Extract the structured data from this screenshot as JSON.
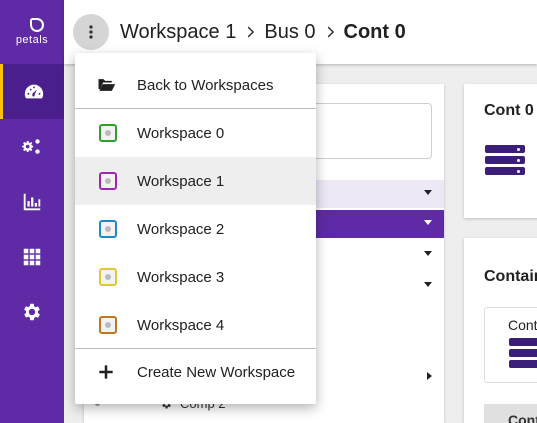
{
  "app": {
    "logo_text": "petals"
  },
  "breadcrumb": {
    "items": [
      "Workspace 1",
      "Bus 0",
      "Cont 0"
    ]
  },
  "sidebar": {
    "items": [
      {
        "id": "dashboard",
        "icon": "dashboard-icon",
        "active": true
      },
      {
        "id": "admin",
        "icon": "gears-icon",
        "active": false
      },
      {
        "id": "monitoring",
        "icon": "bar-chart-icon",
        "active": false
      },
      {
        "id": "apps",
        "icon": "grid-icon",
        "active": false
      },
      {
        "id": "settings",
        "icon": "gear-icon",
        "active": false
      }
    ]
  },
  "menu": {
    "back_label": "Back to Workspaces",
    "workspaces": [
      {
        "label": "Workspace 0",
        "color": "#2e9e2e"
      },
      {
        "label": "Workspace 1",
        "color": "#9c27b0"
      },
      {
        "label": "Workspace 2",
        "color": "#1e88c8"
      },
      {
        "label": "Workspace 3",
        "color": "#e0c830"
      },
      {
        "label": "Workspace 4",
        "color": "#c07820"
      }
    ],
    "create_label": "Create New Workspace"
  },
  "content": {
    "right_card_title": "Cont 0",
    "containers_title": "Contain",
    "inner_label": "Cont",
    "tab_label": "Cont",
    "tree_leaf_label": "Comp 2"
  },
  "colors": {
    "primary": "#5e2aa6",
    "accent": "#ffc107"
  }
}
